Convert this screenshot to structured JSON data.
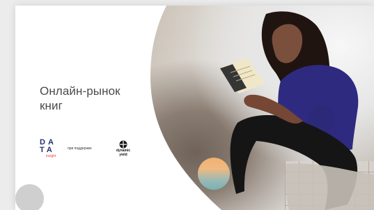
{
  "slide": {
    "title": "Онлайн-рынок\nкниг"
  },
  "logos": {
    "data_insight": {
      "line_1": "DA",
      "line_2": "TA",
      "subtitle": "insight"
    },
    "support_text": "при поддержке",
    "dynamic_yield": {
      "line_1": "dynamic",
      "line_2": "yield"
    }
  },
  "colors": {
    "background": "#ececec",
    "card": "#ffffff",
    "title": "#4a4a4a",
    "data_blue": "#24306b",
    "data_red": "#ef3f37",
    "orb_top": "#f3b072",
    "orb_bottom": "#78b2b0"
  }
}
